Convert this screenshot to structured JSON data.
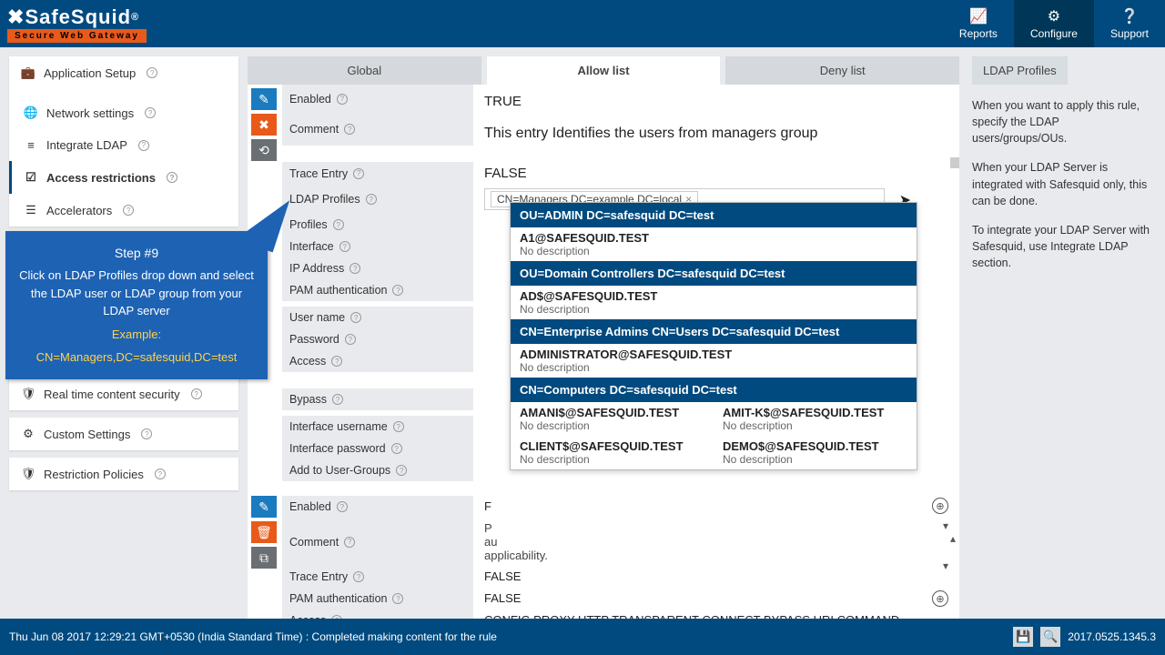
{
  "brand": {
    "name": "SafeSquid",
    "reg": "®",
    "tagline": "Secure Web Gateway"
  },
  "top_actions": {
    "reports": "Reports",
    "configure": "Configure",
    "support": "Support"
  },
  "sidebar": {
    "app_setup": "Application Setup",
    "network": "Network settings",
    "ldap": "Integrate LDAP",
    "access": "Access restrictions",
    "accel": "Accelerators",
    "realtime": "Real time content security",
    "custom": "Custom Settings",
    "restriction": "Restriction Policies"
  },
  "tabs": {
    "global": "Global",
    "allow": "Allow list",
    "deny": "Deny list"
  },
  "form1": {
    "enabled_label": "Enabled",
    "enabled_val": "TRUE",
    "comment_label": "Comment",
    "comment_val": "This entry Identifies the users from managers group",
    "trace_label": "Trace Entry",
    "trace_val": "FALSE",
    "ldap_label": "LDAP Profiles",
    "ldap_tag": "CN=Managers DC=example DC=local",
    "profiles_label": "Profiles",
    "interface_label": "Interface",
    "ip_label": "IP Address",
    "pam_label": "PAM authentication",
    "user_label": "User name",
    "pass_label": "Password",
    "access_label": "Access",
    "bypass_label": "Bypass",
    "ifu_label": "Interface username",
    "ifp_label": "Interface password",
    "add_groups_label": "Add to User-Groups"
  },
  "dropdown": {
    "h1": "OU=ADMIN DC=safesquid DC=test",
    "i1_t": "A1@SAFESQUID.TEST",
    "nd": "No description",
    "h2": "OU=Domain Controllers DC=safesquid DC=test",
    "i2_t": "AD$@SAFESQUID.TEST",
    "h3": "CN=Enterprise Admins CN=Users DC=safesquid DC=test",
    "i3_t": "ADMINISTRATOR@SAFESQUID.TEST",
    "h4": "CN=Computers DC=safesquid DC=test",
    "i4a_t": "AMANI$@SAFESQUID.TEST",
    "i4b_t": "AMIT-K$@SAFESQUID.TEST",
    "i5a_t": "CLIENT$@SAFESQUID.TEST",
    "i5b_t": "DEMO$@SAFESQUID.TEST"
  },
  "form2": {
    "enabled_label": "Enabled",
    "enabled_val": "F",
    "comment_label": "Comment",
    "comment_partial": "P\nau\napplicability.",
    "trace_label": "Trace Entry",
    "trace_val": "FALSE",
    "pam_label": "PAM authentication",
    "pam_val": "FALSE",
    "access_label": "Access",
    "access_val": "CONFIG  PROXY  HTTP  TRANSPARENT  CONNECT  BYPASS  URLCOMMAND"
  },
  "right": {
    "title": "LDAP Profiles",
    "p1": "When you want to apply this rule, specify the LDAP users/groups/OUs.",
    "p2": "When your LDAP Server is integrated with Safesquid only, this can be done.",
    "p3": "To integrate your LDAP Server with Safesquid, use Integrate LDAP section."
  },
  "status": {
    "left": "Thu Jun 08 2017 12:29:21 GMT+0530 (India Standard Time) : Completed making content for the rule",
    "version": "2017.0525.1345.3"
  },
  "callout": {
    "title": "Step #9",
    "l1": "Click on LDAP Profiles drop down and select the LDAP user or LDAP group from your LDAP server",
    "ex_label": "Example:",
    "ex": "CN=Managers,DC=safesquid,DC=test"
  }
}
